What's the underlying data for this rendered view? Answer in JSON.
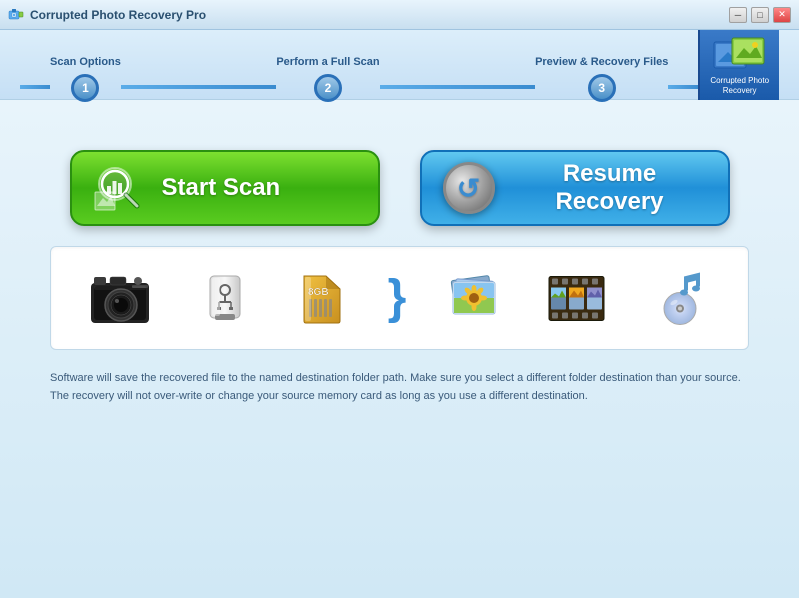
{
  "titlebar": {
    "app_name": "Corrupted Photo Recovery Pro",
    "controls": {
      "minimize": "─",
      "maximize": "□",
      "close": "✕"
    }
  },
  "steps": {
    "step1_label": "Scan Options",
    "step1_num": "1",
    "step2_label": "Perform a Full Scan",
    "step2_num": "2",
    "step3_label": "Preview & Recovery Files",
    "step3_num": "3"
  },
  "logo": {
    "line1": "Corrupted Photo",
    "line2": "Recovery"
  },
  "buttons": {
    "start_scan": "Start Scan",
    "resume_recovery": "Resume Recovery"
  },
  "info_text": "Software will save the recovered file to the named destination folder path. Make sure you select a different folder destination than your source. The recovery will not over-write or change your source memory card as long as you use a different destination."
}
